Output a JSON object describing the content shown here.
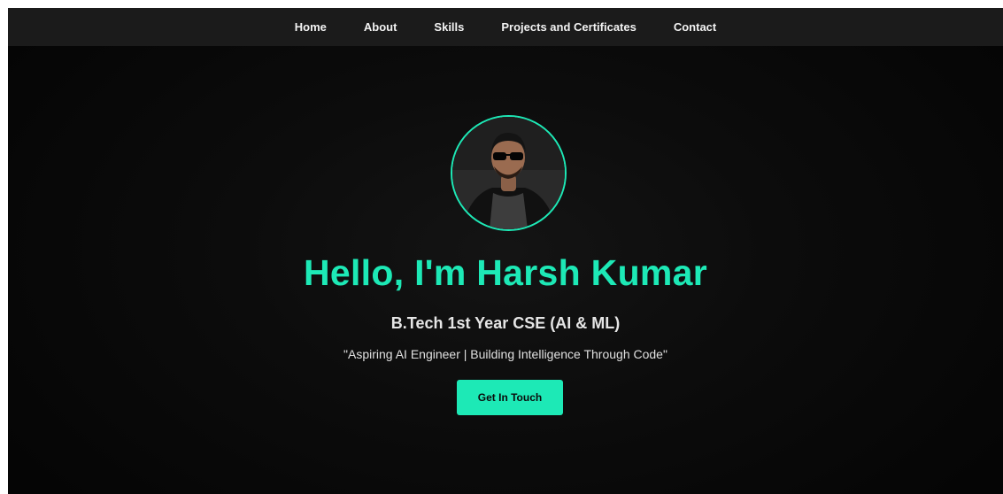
{
  "nav": {
    "items": [
      {
        "label": "Home"
      },
      {
        "label": "About"
      },
      {
        "label": "Skills"
      },
      {
        "label": "Projects and Certificates"
      },
      {
        "label": "Contact"
      }
    ]
  },
  "hero": {
    "title": "Hello, I'm Harsh Kumar",
    "subtitle": "B.Tech 1st Year CSE (AI & ML)",
    "tagline": "\"Aspiring AI Engineer | Building Intelligence Through Code\"",
    "cta_label": "Get In Touch"
  },
  "colors": {
    "accent": "#1de9b6",
    "background": "#0c0c0c",
    "navbar": "#1b1b1b",
    "text": "#f2f2f2"
  },
  "icons": {
    "avatar": "profile-photo"
  }
}
